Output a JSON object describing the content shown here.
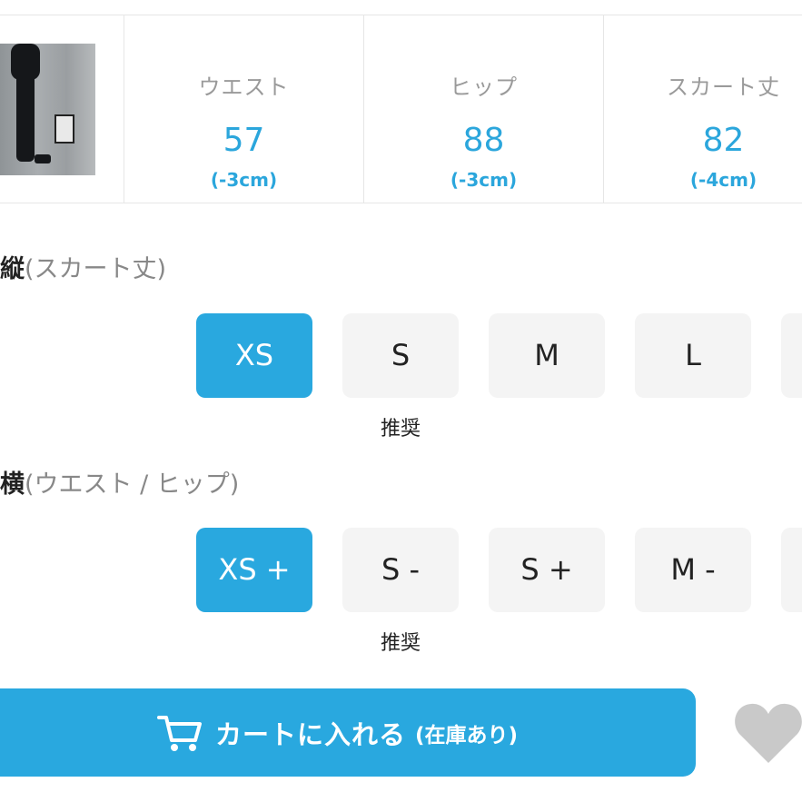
{
  "measurements": [
    {
      "label": "ウエスト",
      "value": "57",
      "diff": "(-3cm)"
    },
    {
      "label": "ヒップ",
      "value": "88",
      "diff": "(-3cm)"
    },
    {
      "label": "スカート丈",
      "value": "82",
      "diff": "(-4cm)"
    }
  ],
  "vertical": {
    "title_bold": "縦",
    "title_rest": "(スカート丈)",
    "sizes": [
      "XS",
      "S",
      "M",
      "L"
    ],
    "selected": "XS",
    "recommended_label": "推奨",
    "recommended_size": "S"
  },
  "horizontal": {
    "title_bold": "横",
    "title_rest": "(ウエスト / ヒップ)",
    "sizes": [
      "XS +",
      "S -",
      "S +",
      "M -"
    ],
    "selected": "XS +",
    "recommended_label": "推奨",
    "recommended_size": "S -"
  },
  "cart": {
    "label": "カートに入れる",
    "stock": "(在庫あり)"
  },
  "colors": {
    "accent": "#29a8df",
    "button_bg": "#f4f4f4",
    "heart": "#c9c9c9"
  },
  "icons": {
    "cart": "cart-icon",
    "favorite": "heart-icon"
  }
}
